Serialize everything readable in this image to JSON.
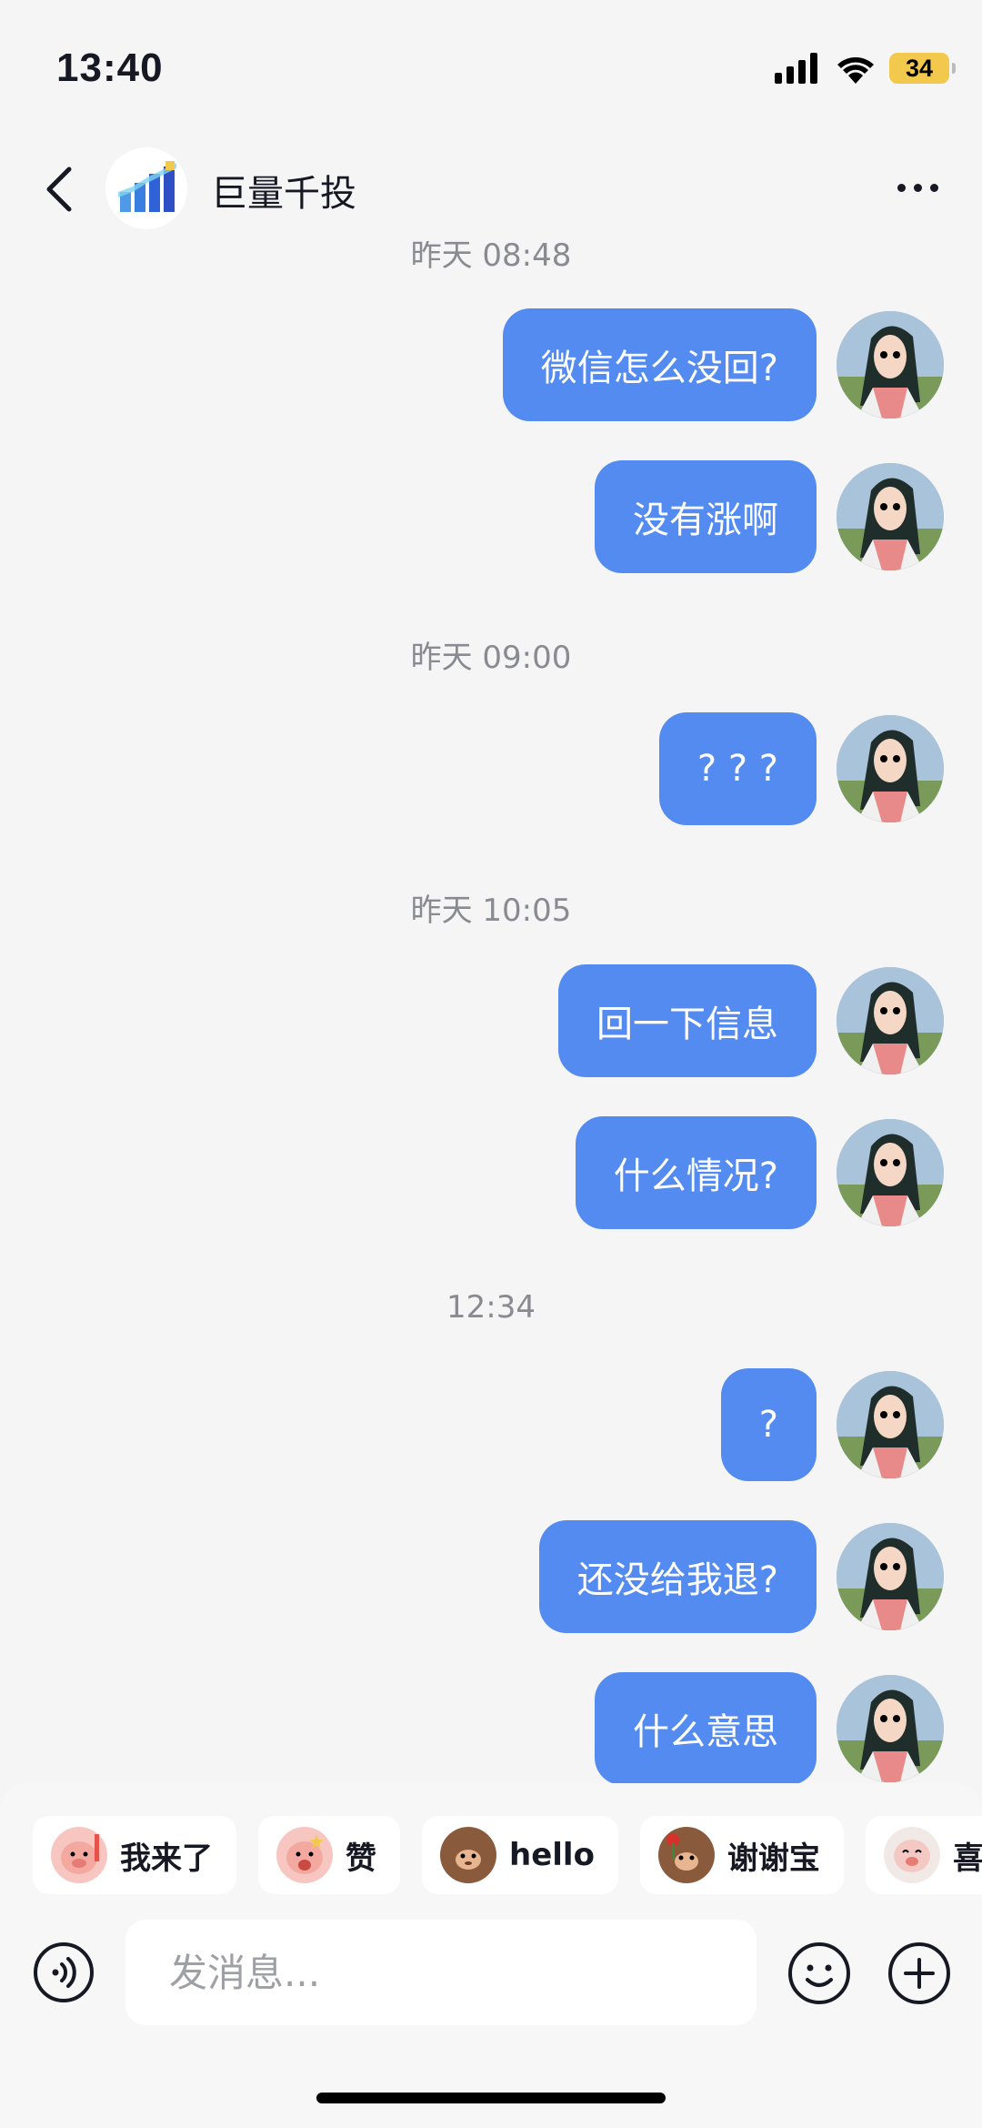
{
  "status_bar": {
    "time": "13:40",
    "battery": "34"
  },
  "header": {
    "title": "巨量千投"
  },
  "messages": [
    {
      "type": "timestamp",
      "text": "昨天 08:48"
    },
    {
      "type": "outgoing",
      "text": "微信怎么没回?"
    },
    {
      "type": "outgoing",
      "text": "没有涨啊"
    },
    {
      "type": "timestamp",
      "text": "昨天 09:00"
    },
    {
      "type": "outgoing",
      "text": "? ? ?"
    },
    {
      "type": "timestamp",
      "text": "昨天 10:05"
    },
    {
      "type": "outgoing",
      "text": "回一下信息"
    },
    {
      "type": "outgoing",
      "text": "什么情况?"
    },
    {
      "type": "timestamp",
      "text": "12:34"
    },
    {
      "type": "outgoing",
      "text": "?"
    },
    {
      "type": "outgoing",
      "text": "还没给我退?"
    },
    {
      "type": "outgoing",
      "text": "什么意思"
    }
  ],
  "quick_replies": [
    {
      "label": "我来了",
      "icon": "pig-wave-emoji"
    },
    {
      "label": "赞",
      "icon": "pig-star-emoji"
    },
    {
      "label": "hello",
      "icon": "monkey-emoji"
    },
    {
      "label": "谢谢宝",
      "icon": "monkey-rose-emoji"
    },
    {
      "label": "喜",
      "icon": "pig-happy-emoji"
    }
  ],
  "composer": {
    "placeholder": "发消息..."
  },
  "colors": {
    "bubble": "#548bf0",
    "background": "#f5f5f6",
    "battery": "#f2c94c"
  }
}
